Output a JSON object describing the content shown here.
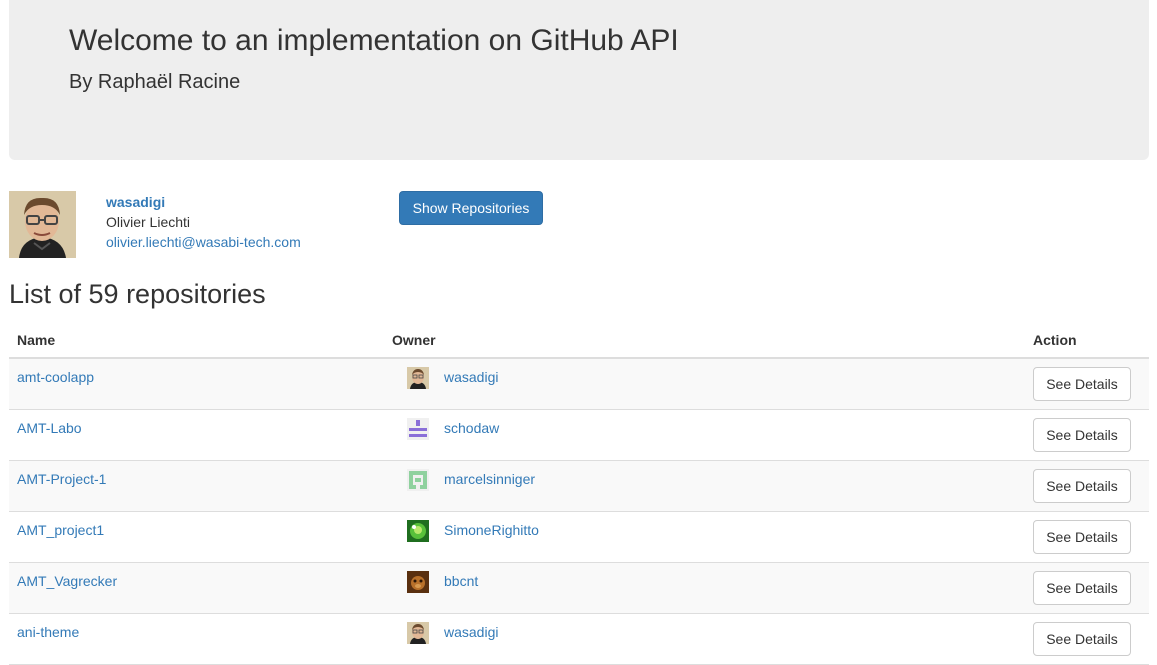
{
  "header": {
    "title": "Welcome to an implementation on GitHub API",
    "subtitle": "By Raphaël Racine"
  },
  "user": {
    "login": "wasadigi",
    "name": "Olivier Liechti",
    "email": "olivier.liechti@wasabi-tech.com",
    "avatar_icon": "cartoon-avatar"
  },
  "show_button_label": "Show Repositories",
  "list_title": "List of 59 repositories",
  "table": {
    "columns": [
      "Name",
      "Owner",
      "Action"
    ],
    "action_label": "See Details",
    "rows": [
      {
        "name": "amt-coolapp",
        "owner": "wasadigi",
        "avatar_icon": "cartoon-avatar"
      },
      {
        "name": "AMT-Labo",
        "owner": "schodaw",
        "avatar_icon": "identicon-purple"
      },
      {
        "name": "AMT-Project-1",
        "owner": "marcelsinniger",
        "avatar_icon": "identicon-green"
      },
      {
        "name": "AMT_project1",
        "owner": "SimoneRighitto",
        "avatar_icon": "photo-avatar-green"
      },
      {
        "name": "AMT_Vagrecker",
        "owner": "bbcnt",
        "avatar_icon": "photo-avatar-brown"
      },
      {
        "name": "ani-theme",
        "owner": "wasadigi",
        "avatar_icon": "cartoon-avatar"
      }
    ]
  },
  "colors": {
    "link": "#337ab7",
    "primary": "#337ab7",
    "jumbotron_bg": "#eeeeee",
    "stripe": "#f9f9f9"
  }
}
